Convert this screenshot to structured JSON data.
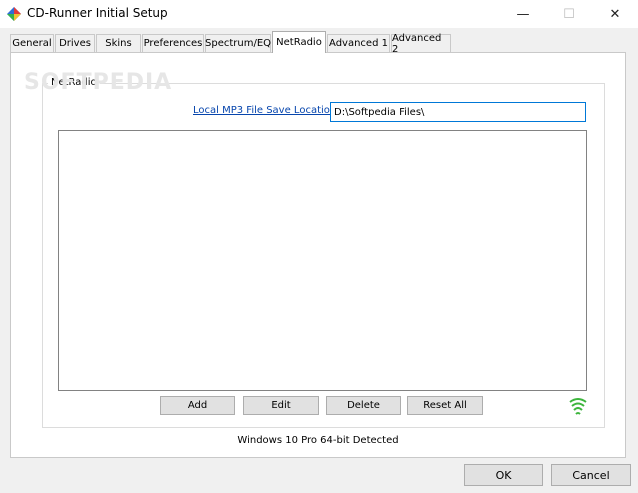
{
  "window": {
    "title": "CD-Runner Initial Setup",
    "minimize": "—",
    "maximize": "☐",
    "close": "✕"
  },
  "tabs": [
    {
      "label": "General"
    },
    {
      "label": "Drives"
    },
    {
      "label": "Skins"
    },
    {
      "label": "Preferences"
    },
    {
      "label": "Spectrum/EQ"
    },
    {
      "label": "NetRadio",
      "active": true
    },
    {
      "label": "Advanced 1"
    },
    {
      "label": "Advanced 2"
    }
  ],
  "netradio": {
    "group_label": "NetRadio",
    "save_location_link": "Local MP3 File Save Location",
    "save_location_value": "D:\\Softpedia Files\\",
    "buttons": {
      "add": "Add",
      "edit": "Edit",
      "delete": "Delete",
      "reset_all": "Reset All"
    },
    "stations": []
  },
  "status_text": "Windows 10 Pro 64-bit Detected",
  "dialog": {
    "ok": "OK",
    "cancel": "Cancel"
  },
  "watermark": "SOFTPEDIA",
  "colors": {
    "link": "#0645ad",
    "focus_border": "#0078d7",
    "signal": "#3db53d"
  }
}
